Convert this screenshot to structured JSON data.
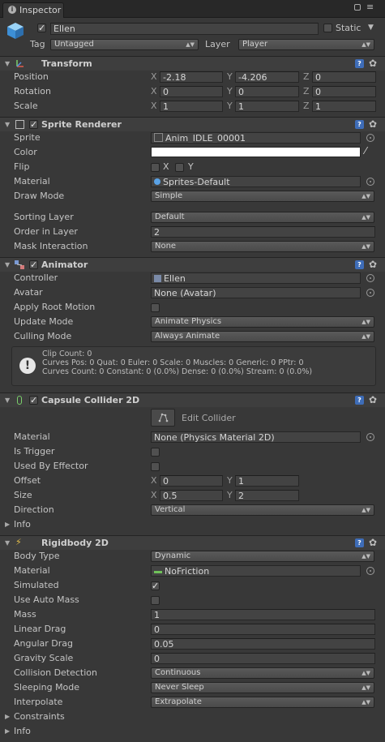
{
  "tab": {
    "label": "Inspector"
  },
  "object": {
    "name": "Ellen",
    "active": true,
    "static_label": "Static",
    "tag_label": "Tag",
    "tag": "Untagged",
    "layer_label": "Layer",
    "layer": "Player"
  },
  "transform": {
    "title": "Transform",
    "position_label": "Position",
    "rotation_label": "Rotation",
    "scale_label": "Scale",
    "position": {
      "x": "-2.18",
      "y": "-4.206",
      "z": "0"
    },
    "rotation": {
      "x": "0",
      "y": "0",
      "z": "0"
    },
    "scale": {
      "x": "1",
      "y": "1",
      "z": "1"
    },
    "axis": {
      "x": "X",
      "y": "Y",
      "z": "Z"
    }
  },
  "sprite_renderer": {
    "title": "Sprite Renderer",
    "sprite_label": "Sprite",
    "sprite": "Anim_IDLE_00001",
    "color_label": "Color",
    "flip_label": "Flip",
    "flip_x": "X",
    "flip_y": "Y",
    "material_label": "Material",
    "material": "Sprites-Default",
    "draw_mode_label": "Draw Mode",
    "draw_mode": "Simple",
    "sorting_layer_label": "Sorting Layer",
    "sorting_layer": "Default",
    "order_label": "Order in Layer",
    "order": "2",
    "mask_label": "Mask Interaction",
    "mask": "None"
  },
  "animator": {
    "title": "Animator",
    "controller_label": "Controller",
    "controller": "Ellen",
    "avatar_label": "Avatar",
    "avatar": "None (Avatar)",
    "root_motion_label": "Apply Root Motion",
    "update_mode_label": "Update Mode",
    "update_mode": "Animate Physics",
    "culling_mode_label": "Culling Mode",
    "culling_mode": "Always Animate",
    "info_lines": [
      "Clip Count: 0",
      "Curves Pos: 0 Quat: 0 Euler: 0 Scale: 0 Muscles: 0 Generic: 0 PPtr: 0",
      "Curves Count: 0 Constant: 0 (0.0%) Dense: 0 (0.0%) Stream: 0 (0.0%)"
    ]
  },
  "capsule": {
    "title": "Capsule Collider 2D",
    "edit_label": "Edit Collider",
    "material_label": "Material",
    "material": "None (Physics Material 2D)",
    "trigger_label": "Is Trigger",
    "effector_label": "Used By Effector",
    "offset_label": "Offset",
    "offset": {
      "x": "0",
      "y": "1"
    },
    "size_label": "Size",
    "size": {
      "x": "0.5",
      "y": "2"
    },
    "direction_label": "Direction",
    "direction": "Vertical",
    "info_label": "Info"
  },
  "rigidbody": {
    "title": "Rigidbody 2D",
    "body_type_label": "Body Type",
    "body_type": "Dynamic",
    "material_label": "Material",
    "material": "NoFriction",
    "simulated_label": "Simulated",
    "auto_mass_label": "Use Auto Mass",
    "mass_label": "Mass",
    "mass": "1",
    "linear_drag_label": "Linear Drag",
    "linear_drag": "0",
    "angular_drag_label": "Angular Drag",
    "angular_drag": "0.05",
    "gravity_label": "Gravity Scale",
    "gravity": "0",
    "collision_label": "Collision Detection",
    "collision": "Continuous",
    "sleeping_label": "Sleeping Mode",
    "sleeping": "Never Sleep",
    "interpolate_label": "Interpolate",
    "interpolate": "Extrapolate",
    "constraints_label": "Constraints",
    "info_label": "Info"
  }
}
